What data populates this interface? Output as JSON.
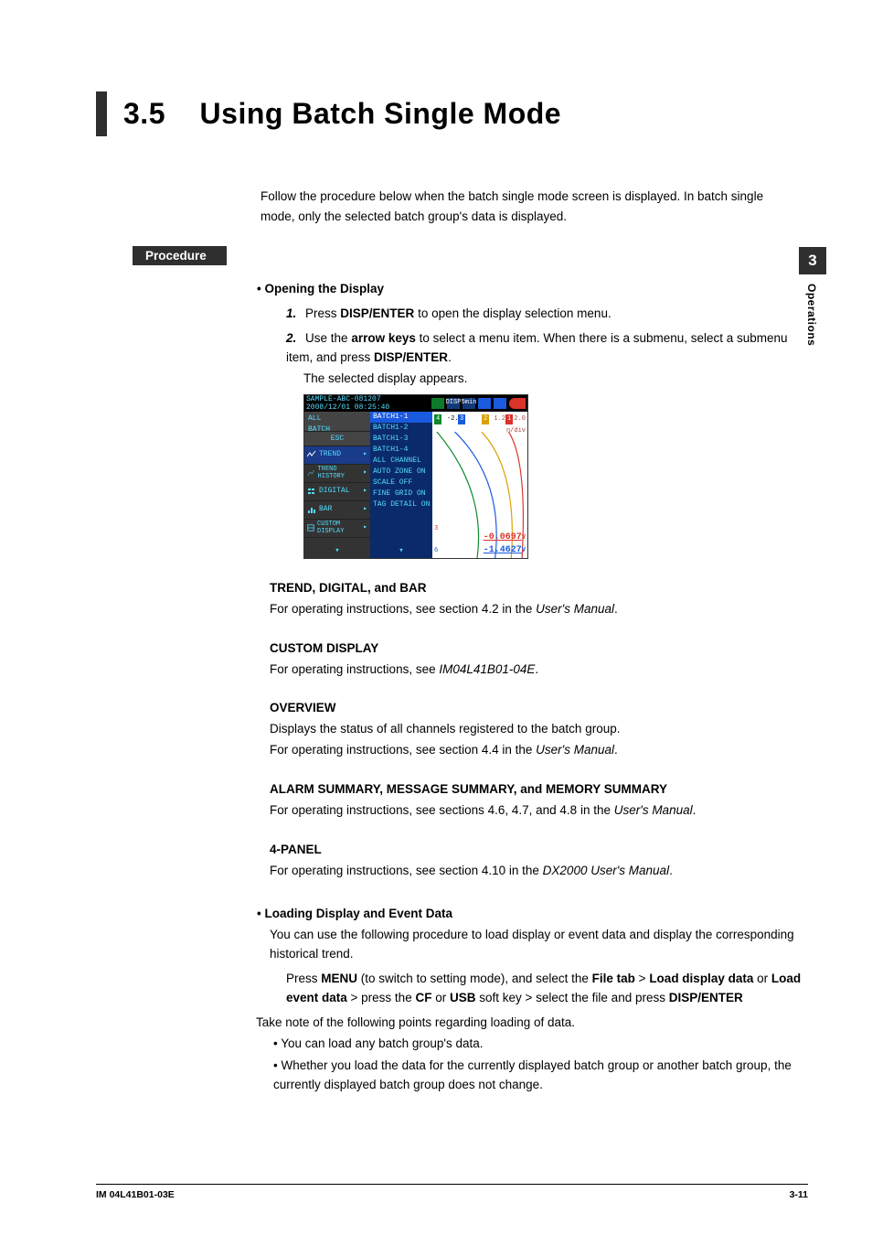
{
  "section_number": "3.5",
  "section_title": "Using Batch Single Mode",
  "intro": "Follow the procedure below when the batch single mode screen is displayed. In batch single mode, only the selected batch group's data is displayed.",
  "procedure_label": "Procedure",
  "opening": {
    "heading": "Opening the Display",
    "step1_num": "1.",
    "step1_pre": "Press ",
    "step1_bold": "DISP/ENTER",
    "step1_post": " to open the display selection menu.",
    "step2_num": "2.",
    "step2_pre": "Use the ",
    "step2_bold": "arrow keys",
    "step2_post": " to select a menu item. When there is a submenu, select a submenu item, and press ",
    "step2_bold2": "DISP/ENTER",
    "step2_post2": ".",
    "step2_note": "The selected display appears."
  },
  "device": {
    "sample": "SAMPLE-ABC-081207",
    "datetime": "2008/12/01 08:25:40",
    "topbar_disp": "DISP",
    "topbar_interval": "5min",
    "left_header_line1": "ALL",
    "left_header_line2": "BATCH",
    "esc": "ESC",
    "menu_items": [
      "TREND",
      "TREND HISTORY",
      "DIGITAL",
      "BAR",
      "CUSTOM DISPLAY"
    ],
    "submenu": [
      "BATCH1-1",
      "BATCH1-2",
      "BATCH1-3",
      "BATCH1-4",
      "ALL CHANNEL",
      "AUTO ZONE ON",
      "SCALE OFF",
      "FINE GRID ON",
      "TAG DETAIL ON"
    ],
    "axis_tags": [
      "4",
      "3",
      "2",
      "1"
    ],
    "axis_neg2": "-2.",
    "axis_12": "1.2",
    "axis_20": "2.0",
    "ndiv": "n/div",
    "chan3": "3",
    "chan6": "6",
    "value1": "-0.0697",
    "value1_unit": "V",
    "value2": "-1.4627",
    "value2_unit": "V"
  },
  "sections": {
    "trend_head": "TREND, DIGITAL, and BAR",
    "trend_body_pre": "For operating instructions, see section 4.2 in the ",
    "trend_body_it": "User's Manual",
    "custom_head": "CUSTOM DISPLAY",
    "custom_body_pre": "For operating instructions, see ",
    "custom_body_it": "IM04L41B01-04E",
    "overview_head": "OVERVIEW",
    "overview_body1": "Displays the status of all channels registered to the batch group.",
    "overview_body2_pre": "For operating instructions, see section 4.4 in the ",
    "overview_body2_it": "User's Manual",
    "alarm_head": "ALARM SUMMARY, MESSAGE SUMMARY, and MEMORY SUMMARY",
    "alarm_body_pre": "For operating instructions, see sections 4.6, 4.7, and 4.8 in the ",
    "alarm_body_it": "User's Manual",
    "panel_head": "4-PANEL",
    "panel_body_pre": "For operating instructions, see section 4.10 in the ",
    "panel_body_it": "DX2000 User's Manual"
  },
  "loading": {
    "heading": "Loading Display and Event Data",
    "intro": "You can use the following procedure to load display or event data and display the corresponding historical trend.",
    "step_pre": "Press ",
    "step_menu": "MENU",
    "step_mid1": " (to switch to setting mode), and select the ",
    "step_filetab": "File tab",
    "step_gt1": " > ",
    "step_loaddisp": "Load display data",
    "step_or": " or ",
    "step_loadevt": "Load event data",
    "step_gt2": " > press the ",
    "step_cf": "CF",
    "step_or2": " or ",
    "step_usb": "USB",
    "step_mid2": " soft key > select the file and press ",
    "step_dispenter": "DISP/ENTER",
    "take_note": "Take note of the following points regarding loading of data.",
    "bullet1": "You can load any batch group's data.",
    "bullet2": "Whether you load the data for the currently displayed batch group or another batch group, the currently displayed batch group does not change."
  },
  "side_tab": {
    "num": "3",
    "label": "Operations"
  },
  "footer": {
    "left": "IM 04L41B01-03E",
    "right": "3-11"
  }
}
